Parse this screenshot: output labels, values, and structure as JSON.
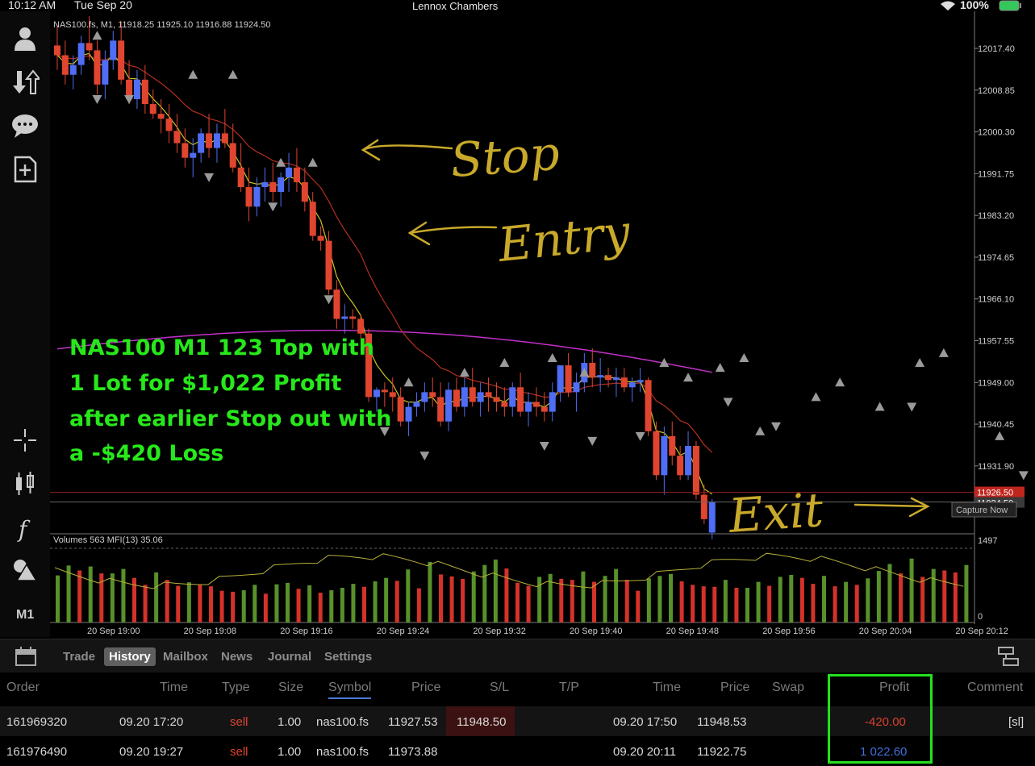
{
  "status_bar": {
    "time": "10:12 AM",
    "date": "Tue Sep 20",
    "user": "Lennox Chambers",
    "battery": "100%"
  },
  "chart_header": {
    "symbol_line": "NAS100.fs, M1, 11918.25 11925.10 11916.88 11924.50",
    "indicator_line": "Volumes 563  MFI(13) 35.06"
  },
  "price_axis": [
    "12017.40",
    "12008.85",
    "12000.30",
    "11991.75",
    "11983.20",
    "11974.65",
    "11966.10",
    "11957.55",
    "11949.00",
    "11940.45",
    "11931.90"
  ],
  "price_tags": {
    "red_line": "11926.50",
    "current": "11924.50",
    "below": "11923.55"
  },
  "volume_axis": {
    "max": "1497",
    "min": "0"
  },
  "time_axis": [
    "20 Sep 19:00",
    "20 Sep 19:08",
    "20 Sep 19:16",
    "20 Sep 19:24",
    "20 Sep 19:32",
    "20 Sep 19:40",
    "20 Sep 19:48",
    "20 Sep 19:56",
    "20 Sep 20:04",
    "20 Sep 20:12"
  ],
  "annotations": {
    "overlay_lines": [
      "NAS100 M1 123 Top with",
      "1 Lot for $1,022 Profit",
      "after earlier Stop out with",
      "a -$420 Loss"
    ],
    "stop": "Stop",
    "entry": "Entry",
    "exit": "Exit",
    "capture": "Capture Now"
  },
  "sidebar": {
    "m1_label": "M1"
  },
  "tabs": [
    "Trade",
    "History",
    "Mailbox",
    "News",
    "Journal",
    "Settings"
  ],
  "active_tab": "History",
  "table": {
    "headers": [
      "Order",
      "Time",
      "Type",
      "Size",
      "Symbol",
      "Price",
      "S/L",
      "T/P",
      "Time",
      "Price",
      "Swap",
      "Profit",
      "Comment"
    ],
    "rows": [
      {
        "order": "161969320",
        "time": "09.20 17:20",
        "type": "sell",
        "size": "1.00",
        "symbol": "nas100.fs",
        "price": "11927.53",
        "sl": "11948.50",
        "tp": "",
        "close_time": "09.20 17:50",
        "close_price": "11948.53",
        "swap": "",
        "profit": "-420.00",
        "comment": "[sl]"
      },
      {
        "order": "161976490",
        "time": "09.20 19:27",
        "type": "sell",
        "size": "1.00",
        "symbol": "nas100.fs",
        "price": "11973.88",
        "sl": "",
        "tp": "",
        "close_time": "09.20 20:11",
        "close_price": "11922.75",
        "swap": "",
        "profit": "1 022.60",
        "comment": ""
      }
    ]
  },
  "colors": {
    "bull": "#4f6df5",
    "bear": "#e0452f",
    "overlay_text": "#27e81b",
    "highlight": "#23e11f",
    "ma_long": "#c130c9",
    "ma_fast": "#c9c423",
    "ma_slow": "#b33020",
    "vol_up": "#58912a",
    "vol_down": "#d4322a",
    "annot": "#c8a92a"
  },
  "chart_data": {
    "type": "candlestick",
    "symbol": "NAS100.fs",
    "timeframe": "M1",
    "ylim": [
      11918.0,
      12025.0
    ],
    "candles": [
      [
        12018.0,
        12022,
        12013,
        12016.0
      ],
      [
        12016.0,
        12019,
        12010,
        12012.0
      ],
      [
        12012.0,
        12016,
        12009,
        12014.0
      ],
      [
        12014.0,
        12020,
        12012,
        12018.5
      ],
      [
        12018.5,
        12024,
        12015,
        12017.0
      ],
      [
        12017.0,
        12019,
        12008,
        12010.0
      ],
      [
        12010.0,
        12017,
        12007,
        12015.0
      ],
      [
        12015.0,
        12021,
        12013,
        12019.0
      ],
      [
        12019.0,
        12023,
        12010,
        12011.0
      ],
      [
        12011.0,
        12015,
        12006,
        12007.0
      ],
      [
        12007.0,
        12013,
        12005,
        12011.0
      ],
      [
        12011.0,
        12014,
        12004,
        12006.0
      ],
      [
        12006.0,
        12009,
        12003,
        12004.0
      ],
      [
        12004.0,
        12007,
        12000,
        12003.0
      ],
      [
        12003.0,
        12006,
        11998,
        12000.5
      ],
      [
        12000.5,
        12004,
        11996,
        11998.0
      ],
      [
        11998.0,
        12001,
        11993,
        11995.0
      ],
      [
        11995.0,
        11999,
        11991,
        11996.0
      ],
      [
        11996.0,
        12001,
        11994,
        12000.0
      ],
      [
        12000.0,
        12004,
        11995,
        11997.0
      ],
      [
        11997.0,
        12002,
        11994,
        12000.0
      ],
      [
        12000.0,
        12005,
        11997,
        11998.0
      ],
      [
        11998.0,
        12002,
        11992,
        11993.0
      ],
      [
        11993.0,
        11998,
        11988,
        11989.0
      ],
      [
        11989.0,
        11993,
        11982,
        11985.0
      ],
      [
        11985.0,
        11991,
        11983,
        11989.0
      ],
      [
        11989.0,
        11993,
        11986,
        11990.0
      ],
      [
        11990.0,
        11994,
        11986,
        11988.0
      ],
      [
        11988.0,
        11992,
        11985,
        11991.0
      ],
      [
        11991.0,
        11996,
        11988,
        11993.0
      ],
      [
        11993.0,
        11997,
        11988,
        11990.0
      ],
      [
        11990.0,
        11993,
        11984,
        11986.0
      ],
      [
        11986.0,
        11988,
        11978,
        11979.0
      ],
      [
        11979.0,
        11981,
        11976,
        11978.0
      ],
      [
        11978.0,
        11980,
        11967,
        11968.0
      ],
      [
        11968.0,
        11970,
        11960,
        11962.0
      ],
      [
        11962.0,
        11965,
        11959,
        11962.5
      ],
      [
        11962.5,
        11964,
        11960,
        11962.0
      ],
      [
        11962.0,
        11963,
        11958,
        11959.0
      ],
      [
        11959.0,
        11960,
        11945,
        11946.0
      ],
      [
        11946.0,
        11948,
        11943,
        11947.5
      ],
      [
        11947.5,
        11949,
        11944,
        11947.0
      ],
      [
        11947.0,
        11950,
        11943,
        11946.0
      ],
      [
        11946.0,
        11948,
        11940,
        11941.0
      ],
      [
        11941.0,
        11945,
        11938,
        11944.0
      ],
      [
        11944.0,
        11947,
        11942,
        11945.0
      ],
      [
        11945.0,
        11949,
        11943,
        11947.0
      ],
      [
        11947.0,
        11950,
        11944,
        11946.0
      ],
      [
        11946.0,
        11949,
        11940,
        11941.0
      ],
      [
        11941.0,
        11949,
        11939,
        11947.5
      ],
      [
        11947.5,
        11950,
        11943,
        11944.0
      ],
      [
        11944.0,
        11950,
        11942,
        11948.0
      ],
      [
        11948.0,
        11952,
        11944,
        11945.0
      ],
      [
        11945.0,
        11949,
        11942,
        11947.0
      ],
      [
        11947.0,
        11950,
        11943,
        11946.0
      ],
      [
        11946.0,
        11949,
        11943,
        11945.0
      ],
      [
        11945.0,
        11948,
        11942,
        11944.0
      ],
      [
        11944.0,
        11949,
        11942,
        11948.0
      ],
      [
        11948.0,
        11951,
        11942,
        11943.0
      ],
      [
        11943.0,
        11947,
        11940,
        11945.0
      ],
      [
        11945.0,
        11948,
        11942,
        11944.0
      ],
      [
        11944.0,
        11947,
        11941,
        11943.0
      ],
      [
        11943.0,
        11949,
        11941,
        11947.0
      ],
      [
        11947.0,
        11952,
        11945,
        11952.5
      ],
      [
        11952.5,
        11955,
        11946,
        11947.0
      ],
      [
        11947.0,
        11951,
        11943,
        11949.0
      ],
      [
        11949.0,
        11955,
        11947,
        11953.0
      ],
      [
        11953.0,
        11956,
        11948,
        11950.0
      ],
      [
        11950.0,
        11954,
        11947,
        11950.5
      ],
      [
        11950.5,
        11952,
        11948,
        11949.5
      ],
      [
        11949.5,
        11952,
        11946,
        11950.0
      ],
      [
        11950.0,
        11952,
        11947,
        11948.0
      ],
      [
        11948.0,
        11950,
        11945,
        11949.0
      ],
      [
        11949.0,
        11952,
        11947,
        11949.5
      ],
      [
        11949.5,
        11950,
        11938,
        11939.0
      ],
      [
        11939.0,
        11941,
        11929,
        11930.0
      ],
      [
        11930.0,
        11940,
        11926,
        11938.0
      ],
      [
        11938.0,
        11941,
        11932,
        11934.0
      ],
      [
        11934.0,
        11936,
        11929,
        11930.0
      ],
      [
        11930.0,
        11939,
        11929,
        11936.0
      ],
      [
        11936.0,
        11937,
        11925,
        11926.0
      ],
      [
        11926.0,
        11928,
        11920,
        11921.0
      ],
      [
        11918.25,
        11925.1,
        11916.88,
        11924.5
      ]
    ],
    "markers_up": [
      [
        5,
        12020
      ],
      [
        17,
        12012
      ],
      [
        22,
        12012
      ],
      [
        28,
        11994
      ],
      [
        32,
        11994
      ],
      [
        44,
        11949
      ],
      [
        51,
        11951
      ],
      [
        56,
        11953
      ],
      [
        62,
        11954
      ],
      [
        66,
        11951
      ],
      [
        76,
        11953
      ],
      [
        79,
        11950
      ],
      [
        83,
        11952
      ],
      [
        86,
        11954
      ],
      [
        88,
        11939
      ],
      [
        95,
        11946
      ],
      [
        98,
        11949
      ],
      [
        103,
        11944
      ],
      [
        108,
        11953
      ],
      [
        111,
        11955
      ],
      [
        118,
        11938
      ]
    ],
    "markers_down": [
      [
        5,
        12007
      ],
      [
        9,
        12007
      ],
      [
        19,
        11991
      ],
      [
        27,
        11985
      ],
      [
        34,
        11966
      ],
      [
        41,
        11939
      ],
      [
        46,
        11934
      ],
      [
        61,
        11936
      ],
      [
        67,
        11937
      ],
      [
        73,
        11938
      ],
      [
        84,
        11945
      ],
      [
        90,
        11940
      ],
      [
        107,
        11944
      ],
      [
        121,
        11930
      ]
    ],
    "volumes": [
      950,
      1150,
      1050,
      1130,
      990,
      990,
      1080,
      900,
      760,
      1010,
      860,
      740,
      810,
      760,
      730,
      640,
      620,
      650,
      760,
      580,
      770,
      800,
      680,
      750,
      600,
      650,
      700,
      780,
      720,
      830,
      900,
      840,
      1070,
      690,
      1220,
      970,
      930,
      880,
      1030,
      1160,
      1270,
      1090,
      800,
      740,
      920,
      980,
      880,
      860,
      1030,
      820,
      940,
      1080,
      860,
      640,
      890,
      940,
      980,
      830,
      760,
      730,
      720,
      860,
      700,
      700,
      820,
      740,
      920,
      960,
      900,
      780,
      940,
      730,
      820,
      760,
      890,
      1040,
      1180,
      990,
      1290,
      920,
      1080,
      1050,
      1010,
      1160
    ],
    "vol_range": [
      0,
      1497
    ]
  }
}
